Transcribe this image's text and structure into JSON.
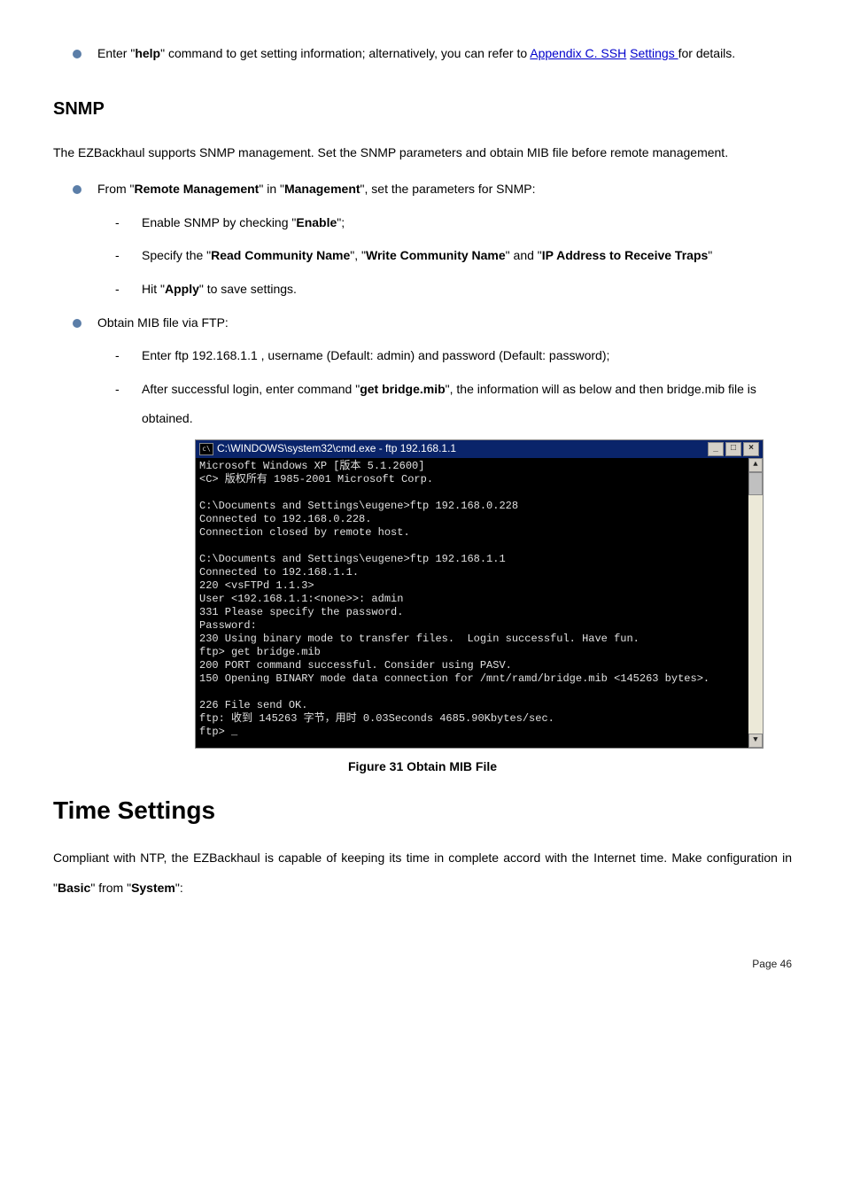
{
  "intro_bullet": {
    "pre": "Enter \"",
    "cmd": "help",
    "mid": "\" command to get setting information; alternatively, you can refer to ",
    "link1": "Appendix C. SSH",
    "link2": "Settings ",
    "post": "for details."
  },
  "snmp": {
    "heading": "SNMP",
    "para": "The EZBackhaul supports SNMP management. Set the SNMP parameters and obtain MIB file before remote management.",
    "b1": {
      "pre": "From \"",
      "b1t": "Remote Management",
      "mid": "\" in \"",
      "b2t": "Management",
      "post": "\", set the parameters for SNMP:"
    },
    "d1": {
      "pre": "Enable SNMP by checking \"",
      "b": "Enable",
      "post": "\";"
    },
    "d2": {
      "pre": "Specify the \"",
      "b1t": "Read Community Name",
      "m1": "\", \"",
      "b2t": "Write Community Name",
      "m2": "\" and \"",
      "b3t": "IP Address to Receive Traps",
      "post": "\""
    },
    "d3": {
      "pre": "Hit \"",
      "b": "Apply",
      "post": "\" to save settings."
    },
    "b2text": "Obtain MIB file via FTP:",
    "d4": "Enter ftp 192.168.1.1 , username (Default: admin) and password (Default: password);",
    "d5": {
      "pre": "After successful login, enter command \"",
      "b": "get bridge.mib",
      "post": "\", the information will as below and then bridge.mib file is obtained."
    }
  },
  "cmd": {
    "title_cmd": " C:\\WINDOWS\\system32\\cmd.exe - ftp 192.168.1.1",
    "min": "_",
    "max": "□",
    "close": "×",
    "up": "▲",
    "down": "▼",
    "body": "Microsoft Windows XP [版本 5.1.2600]\n<C> 版权所有 1985-2001 Microsoft Corp.\n\nC:\\Documents and Settings\\eugene>ftp 192.168.0.228\nConnected to 192.168.0.228.\nConnection closed by remote host.\n\nC:\\Documents and Settings\\eugene>ftp 192.168.1.1\nConnected to 192.168.1.1.\n220 <vsFTPd 1.1.3>\nUser <192.168.1.1:<none>>: admin\n331 Please specify the password.\nPassword:\n230 Using binary mode to transfer files.  Login successful. Have fun.\nftp> get bridge.mib\n200 PORT command successful. Consider using PASV.\n150 Opening BINARY mode data connection for /mnt/ramd/bridge.mib <145263 bytes>.\n\n226 File send OK.\nftp: 收到 145263 字节，用时 0.03Seconds 4685.90Kbytes/sec.\nftp> _\n"
  },
  "caption": "Figure 31 Obtain MIB File",
  "time": {
    "heading": "Time Settings",
    "para_pre": "Compliant with NTP, the EZBackhaul is capable of keeping its time in complete accord with the Internet time. Make configuration in \"",
    "b1": "Basic",
    "mid": "\" from \"",
    "b2": "System",
    "post": "\":"
  },
  "footer": "Page  46"
}
